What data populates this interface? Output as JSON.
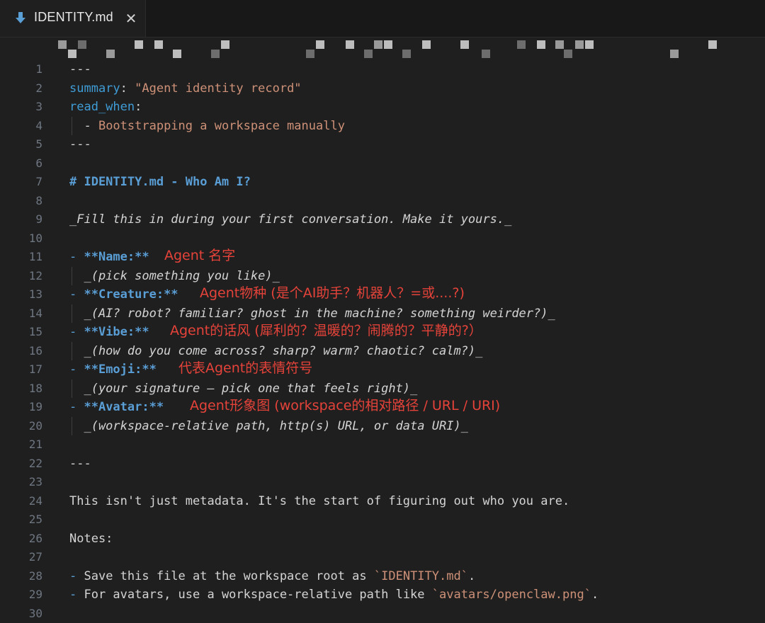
{
  "tab": {
    "title": "IDENTITY.md",
    "close_icon": "close-icon",
    "file_icon": "markdown-download-icon"
  },
  "colors": {
    "accent_blue": "#3f9cd6",
    "string": "#ce9178",
    "annotation_red": "#e5433a"
  },
  "lines": [
    {
      "n": "1",
      "parts": [
        {
          "t": "---",
          "c": "c-dash"
        }
      ]
    },
    {
      "n": "2",
      "parts": [
        {
          "t": "summary",
          "c": "c-key"
        },
        {
          "t": ": ",
          "c": "c-plain"
        },
        {
          "t": "\"Agent identity record\"",
          "c": "c-str"
        }
      ]
    },
    {
      "n": "3",
      "parts": [
        {
          "t": "read_when",
          "c": "c-key"
        },
        {
          "t": ":",
          "c": "c-plain"
        }
      ]
    },
    {
      "n": "4",
      "guide": true,
      "parts": [
        {
          "t": "  - ",
          "c": "c-plain"
        },
        {
          "t": "Bootstrapping a workspace manually",
          "c": "c-str"
        }
      ]
    },
    {
      "n": "5",
      "parts": [
        {
          "t": "---",
          "c": "c-dash"
        }
      ]
    },
    {
      "n": "6",
      "parts": []
    },
    {
      "n": "7",
      "parts": [
        {
          "t": "# IDENTITY.md - Who Am I?",
          "c": "c-h"
        }
      ]
    },
    {
      "n": "8",
      "parts": []
    },
    {
      "n": "9",
      "parts": [
        {
          "t": "_Fill this in during your first conversation. Make it yours._",
          "c": "c-ital"
        }
      ]
    },
    {
      "n": "10",
      "parts": []
    },
    {
      "n": "11",
      "parts": [
        {
          "t": "- ",
          "c": "c-bullet"
        },
        {
          "t": "**Name:**",
          "c": "c-bold"
        }
      ]
    },
    {
      "n": "12",
      "guide": true,
      "parts": [
        {
          "t": "  _(pick something you like)_",
          "c": "c-ital"
        }
      ]
    },
    {
      "n": "13",
      "parts": [
        {
          "t": "- ",
          "c": "c-bullet"
        },
        {
          "t": "**Creature:**",
          "c": "c-bold"
        }
      ]
    },
    {
      "n": "14",
      "guide": true,
      "parts": [
        {
          "t": "  _(AI? robot? familiar? ghost in the machine? something weirder?)_",
          "c": "c-ital"
        }
      ]
    },
    {
      "n": "15",
      "parts": [
        {
          "t": "- ",
          "c": "c-bullet"
        },
        {
          "t": "**Vibe:**",
          "c": "c-bold"
        }
      ]
    },
    {
      "n": "16",
      "guide": true,
      "parts": [
        {
          "t": "  _(how do you come across? sharp? warm? chaotic? calm?)_",
          "c": "c-ital"
        }
      ]
    },
    {
      "n": "17",
      "parts": [
        {
          "t": "- ",
          "c": "c-bullet"
        },
        {
          "t": "**Emoji:**",
          "c": "c-bold"
        }
      ]
    },
    {
      "n": "18",
      "guide": true,
      "parts": [
        {
          "t": "  _(your signature — pick one that feels right)_",
          "c": "c-ital"
        }
      ]
    },
    {
      "n": "19",
      "parts": [
        {
          "t": "- ",
          "c": "c-bullet"
        },
        {
          "t": "**Avatar:**",
          "c": "c-bold"
        }
      ]
    },
    {
      "n": "20",
      "guide": true,
      "parts": [
        {
          "t": "  _(workspace-relative path, http(s) URL, or data URI)_",
          "c": "c-ital"
        }
      ]
    },
    {
      "n": "21",
      "parts": []
    },
    {
      "n": "22",
      "parts": [
        {
          "t": "---",
          "c": "c-dash"
        }
      ]
    },
    {
      "n": "23",
      "parts": []
    },
    {
      "n": "24",
      "parts": [
        {
          "t": "This isn't just metadata. It's the start of figuring out who you are.",
          "c": "c-plain"
        }
      ]
    },
    {
      "n": "25",
      "parts": []
    },
    {
      "n": "26",
      "parts": [
        {
          "t": "Notes:",
          "c": "c-plain"
        }
      ]
    },
    {
      "n": "27",
      "parts": []
    },
    {
      "n": "28",
      "parts": [
        {
          "t": "- ",
          "c": "c-bullet"
        },
        {
          "t": "Save this file at the workspace root as ",
          "c": "c-plain"
        },
        {
          "t": "`IDENTITY.md`",
          "c": "c-code"
        },
        {
          "t": ".",
          "c": "c-plain"
        }
      ]
    },
    {
      "n": "29",
      "parts": [
        {
          "t": "- ",
          "c": "c-bullet"
        },
        {
          "t": "For avatars, use a workspace-relative path like ",
          "c": "c-plain"
        },
        {
          "t": "`avatars/openclaw.png`",
          "c": "c-code"
        },
        {
          "t": ".",
          "c": "c-plain"
        }
      ]
    },
    {
      "n": "30",
      "parts": []
    }
  ],
  "annotations": [
    {
      "line": "11",
      "text": "Agent 名字"
    },
    {
      "line": "13",
      "text": "Agent物种 (是个AI助手？机器人？=或....?)"
    },
    {
      "line": "15",
      "text": "Agent的话风 (犀利的？温暖的？闹腾的？平静的?）"
    },
    {
      "line": "17",
      "text": "代表Agent的表情符号"
    },
    {
      "line": "19",
      "text": "Agent形象图 (workspace的相对路径 / URL / URI)"
    }
  ]
}
